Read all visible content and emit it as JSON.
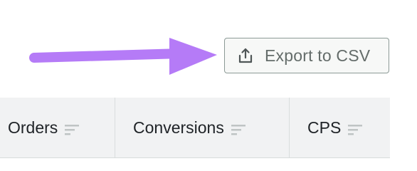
{
  "toolbar": {
    "export_label": "Export to CSV",
    "export_icon": "export-upload-icon"
  },
  "annotation": {
    "arrow_color": "#b57bf7"
  },
  "table": {
    "columns": [
      {
        "label": "Orders",
        "sort_icon": "sort-icon"
      },
      {
        "label": "Conversions",
        "sort_icon": "sort-icon"
      },
      {
        "label": "CPS",
        "sort_icon": "sort-icon"
      }
    ]
  },
  "colors": {
    "button_border": "#8c9a96",
    "button_text": "#646c6a",
    "header_background": "#f1f2f3",
    "header_text": "#1f2327",
    "sort_icon": "#bfc4c4"
  }
}
